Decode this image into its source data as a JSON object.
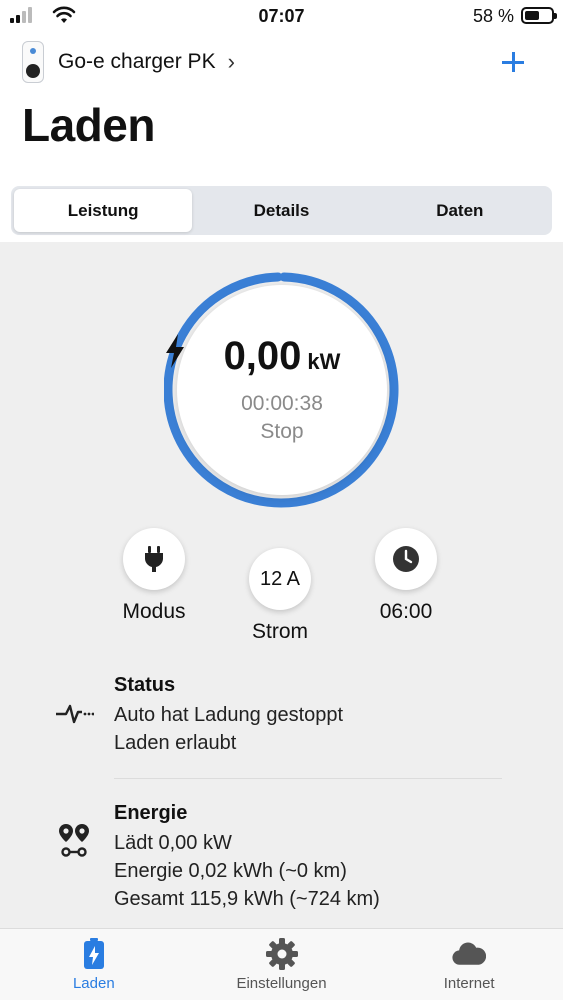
{
  "status_bar": {
    "time": "07:07",
    "battery": "58 %",
    "battery_level": 0.58
  },
  "header": {
    "device_name": "Go-e charger PK",
    "chevron": "›",
    "add_icon": "plus-icon",
    "title": "Laden"
  },
  "tabs": [
    {
      "label": "Leistung",
      "active": true
    },
    {
      "label": "Details",
      "active": false
    },
    {
      "label": "Daten",
      "active": false
    }
  ],
  "gauge": {
    "power_value": "0,00",
    "power_unit": "kW",
    "timer": "00:00:38",
    "state": "Stop",
    "ring_color": "#3a7fd5"
  },
  "controls": {
    "modus": {
      "label": "Modus",
      "icon": "plug-icon"
    },
    "strom": {
      "value": "12 A",
      "label": "Strom"
    },
    "time": {
      "label": "06:00",
      "icon": "clock-icon"
    }
  },
  "status": {
    "heading": "Status",
    "line1": "Auto hat Ladung gestoppt",
    "line2": "Laden erlaubt",
    "icon": "pulse-icon"
  },
  "energy": {
    "heading": "Energie",
    "line1": "Lädt 0,00 kW",
    "line2": "Energie 0,02 kWh (~0 km)",
    "line3": "Gesamt 115,9 kWh (~724 km)",
    "icon": "route-icon"
  },
  "tabbar": [
    {
      "label": "Laden",
      "icon": "battery-bolt-icon",
      "active": true
    },
    {
      "label": "Einstellungen",
      "icon": "gear-icon",
      "active": false
    },
    {
      "label": "Internet",
      "icon": "cloud-icon",
      "active": false
    }
  ],
  "colors": {
    "accent": "#2a7de1",
    "ring": "#3a7fd5"
  }
}
